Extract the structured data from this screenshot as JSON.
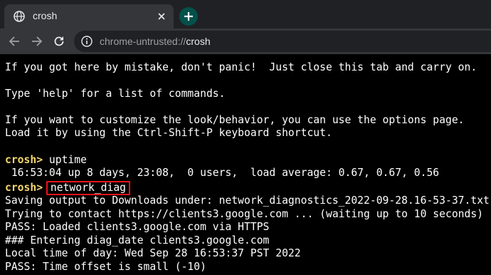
{
  "tab": {
    "title": "crosh",
    "favicon": "globe-icon"
  },
  "toolbar": {
    "url_scheme": "chrome-untrusted://",
    "url_host": "crosh"
  },
  "terminal": {
    "intro1": "If you got here by mistake, don't panic!  Just close this tab and carry on.",
    "intro2": "Type 'help' for a list of commands.",
    "intro3": "If you want to customize the look/behavior, you can use the options page.",
    "intro4": "Load it by using the Ctrl-Shift-P keyboard shortcut.",
    "prompt": "crosh>",
    "cmd1": "uptime",
    "uptime_out": " 16:53:04 up 8 days, 23:08,  0 users,  load average: 0.67, 0.67, 0.56",
    "cmd2": "network_diag",
    "out1": "Saving output to Downloads under: network_diagnostics_2022-09-28.16-53-37.txt",
    "out2": "Trying to contact https://clients3.google.com ... (waiting up to 10 seconds)",
    "out3": "PASS: Loaded clients3.google.com via HTTPS",
    "out4": "### Entering diag_date clients3.google.com",
    "out5": "Local time of day: Wed Sep 28 16:53:37 PST 2022",
    "out6": "PASS: Time offset is small (-10)"
  },
  "colors": {
    "prompt": "#f5d76e",
    "highlight_box": "#e8141c",
    "new_tab_button": "#04504a"
  }
}
